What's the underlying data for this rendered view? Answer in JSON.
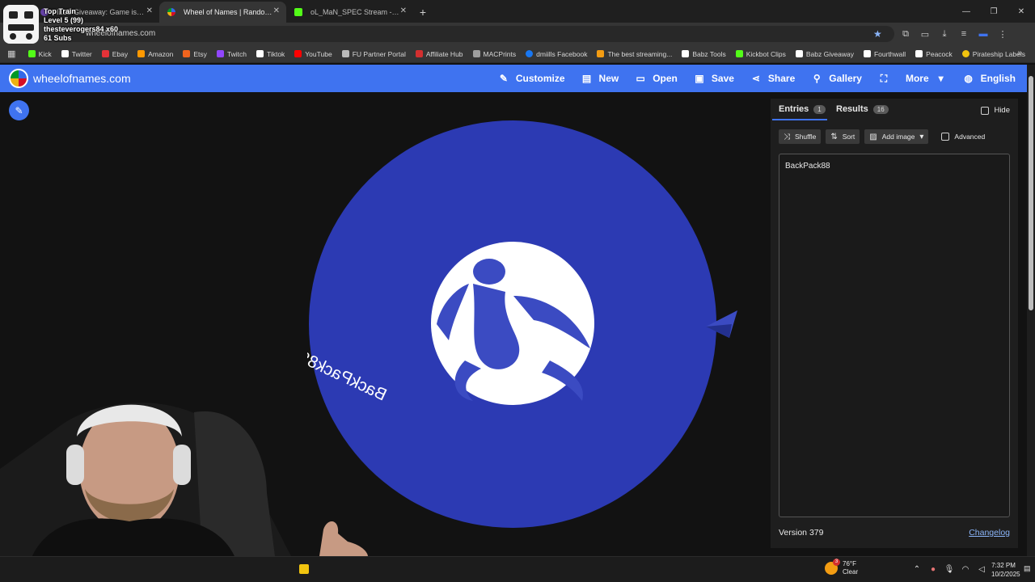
{
  "browser": {
    "tabs": [
      {
        "label": "ILLS Giveaway: Game is now...",
        "active": false,
        "favicon_color": "#6441a5"
      },
      {
        "label": "Wheel of Names | Random name picker",
        "active": true,
        "favicon_color": "#3369e8"
      },
      {
        "label": "oL_MaN_SPEC Stream - Watch Live",
        "active": false,
        "favicon_color": "#53fc18"
      }
    ],
    "new_tab_label": "+",
    "url": "wheelofnames.com",
    "bookmarks": [
      {
        "label": "Kick",
        "color": "#53fc18"
      },
      {
        "label": "Twitter",
        "color": "#ffffff"
      },
      {
        "label": "Ebay",
        "color": "#e53238"
      },
      {
        "label": "Amazon",
        "color": "#ff9900"
      },
      {
        "label": "Etsy",
        "color": "#f1641e"
      },
      {
        "label": "Twitch",
        "color": "#9146ff"
      },
      {
        "label": "Tiktok",
        "color": "#ffffff"
      },
      {
        "label": "YouTube",
        "color": "#ff0000"
      },
      {
        "label": "FU Partner Portal",
        "color": "#bbbbbb"
      },
      {
        "label": "Affiliate Hub",
        "color": "#d32f2f"
      },
      {
        "label": "MACPrints",
        "color": "#9e9e9e"
      },
      {
        "label": "dmiills Facebook",
        "color": "#1877f2"
      },
      {
        "label": "The best streaming...",
        "color": "#f39c12"
      },
      {
        "label": "Babz Tools",
        "color": "#ffffff"
      },
      {
        "label": "Kickbot Clips",
        "color": "#53fc18"
      },
      {
        "label": "Babz Giveaway",
        "color": "#ffffff"
      },
      {
        "label": "Fourthwall",
        "color": "#ffffff"
      },
      {
        "label": "Peacock",
        "color": "#ffffff"
      },
      {
        "label": "Pirateship Labels",
        "color": "#f1c40f"
      }
    ]
  },
  "overlay": {
    "line1": "Top Train",
    "line2": "Level 5  (99)",
    "line3": "thesteverogers84 x60",
    "line4": "61 Subs"
  },
  "app": {
    "brand": "wheelofnames.com",
    "menu": [
      {
        "label": "Customize",
        "icon": "palette-icon",
        "glyph": "🎨"
      },
      {
        "label": "New",
        "icon": "file-icon",
        "glyph": "🗋"
      },
      {
        "label": "Open",
        "icon": "folder-icon",
        "glyph": "🗁"
      },
      {
        "label": "Save",
        "icon": "save-icon",
        "glyph": "💾"
      },
      {
        "label": "Share",
        "icon": "share-icon",
        "glyph": "⤴"
      },
      {
        "label": "Gallery",
        "icon": "search-icon",
        "glyph": "🔍"
      },
      {
        "label": "",
        "icon": "fullscreen-icon",
        "glyph": "⛶"
      },
      {
        "label": "More",
        "icon": "chevron-down-icon",
        "glyph": "▾"
      },
      {
        "label": "English",
        "icon": "globe-icon",
        "glyph": "🌐"
      }
    ],
    "wheel": {
      "entry": "BackPack88",
      "color": "#2c3ab3",
      "center_color": "#ffffff"
    },
    "panel": {
      "entries_tab": "Entries",
      "entries_count": "1",
      "results_tab": "Results",
      "results_count": "16",
      "hide_label": "Hide",
      "shuffle_label": "Shuffle",
      "sort_label": "Sort",
      "add_image_label": "Add image",
      "advanced_label": "Advanced",
      "entries_text": "BackPack88",
      "version": "Version 379",
      "changelog": "Changelog"
    }
  },
  "taskbar": {
    "temperature": "76°F",
    "condition": "Clear",
    "weather_badge": "3",
    "time": "7:32 PM",
    "date": "10/2/2025"
  },
  "colors": {
    "accent": "#3f73f0",
    "background": "#121212",
    "panel": "#1e1e1e",
    "link": "#8ab4f8"
  }
}
